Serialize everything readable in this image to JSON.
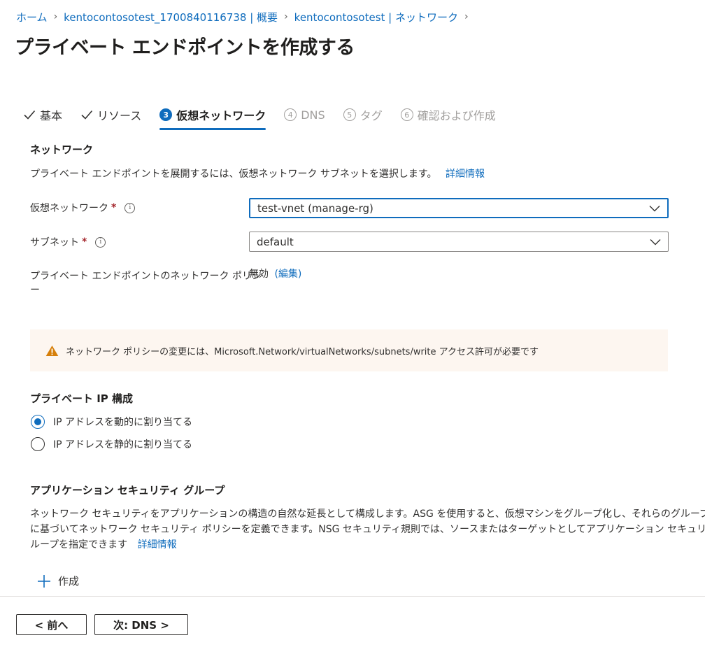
{
  "breadcrumb": {
    "items": [
      "ホーム",
      "kentocontosotest_1700840116738 | 概要",
      "kentocontosotest | ネットワーク"
    ]
  },
  "page": {
    "title": "プライベート エンドポイントを作成する",
    "more": "…"
  },
  "tabs": [
    {
      "label": "基本",
      "state": "done"
    },
    {
      "label": "リソース",
      "state": "done"
    },
    {
      "label": "仮想ネットワーク",
      "state": "active",
      "num": "3"
    },
    {
      "label": "DNS",
      "state": "disabled",
      "num": "4"
    },
    {
      "label": "タグ",
      "state": "disabled",
      "num": "5"
    },
    {
      "label": "確認および作成",
      "state": "disabled",
      "num": "6"
    }
  ],
  "network": {
    "heading": "ネットワーク",
    "description": "プライベート エンドポイントを展開するには、仮想ネットワーク サブネットを選択します。",
    "learn_more": "詳細情報",
    "vnet_label": "仮想ネットワーク",
    "vnet_value": "test-vnet (manage-rg)",
    "subnet_label": "サブネット",
    "subnet_value": "default",
    "required_mark": "*",
    "policy_label_line1": "プライベート エンドポイントのネットワーク ポリシ",
    "policy_label_line2": "ー",
    "policy_value": "無効",
    "policy_edit": "(編集)"
  },
  "warning": {
    "text": "ネットワーク ポリシーの変更には、Microsoft.Network/virtualNetworks/subnets/write アクセス許可が必要です"
  },
  "private_ip": {
    "heading": "プライベート IP 構成",
    "options": [
      {
        "label": "IP アドレスを動的に割り当てる",
        "selected": true
      },
      {
        "label": "IP アドレスを静的に割り当てる",
        "selected": false
      }
    ]
  },
  "asg": {
    "heading": "アプリケーション セキュリティ グループ",
    "line1": "ネットワーク セキュリティをアプリケーションの構造の自然な延長として構成します。ASG を使用すると、仮想マシンをグループ化し、それらのグループ",
    "line2": "に基づいてネットワーク セキュリティ ポリシーを定義できます。NSG セキュリティ規則では、ソースまたはターゲットとしてアプリケーション セキュリティ グ",
    "line3": "ループを指定できます",
    "learn_more": "詳細情報",
    "create_label": "作成"
  },
  "footer": {
    "prev_label": "< 前へ",
    "next_label": "次: DNS >"
  },
  "colors": {
    "accent": "#0f6cbd",
    "warning_icon": "#d67f0a",
    "warning_bg": "#fdf6f0",
    "required": "#a4262c"
  }
}
